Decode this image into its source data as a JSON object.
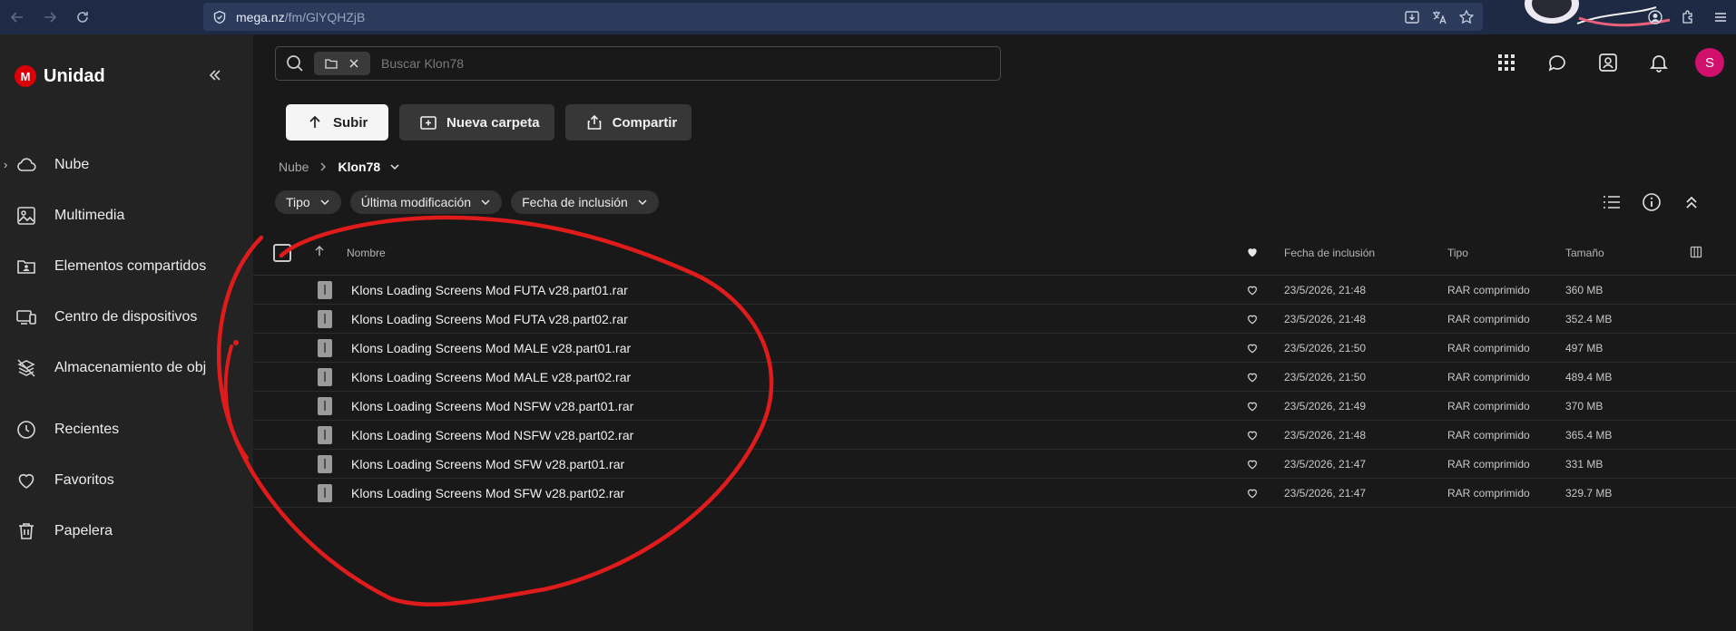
{
  "browser": {
    "url_host": "mega.nz",
    "url_path": "/fm/GlYQHZjB"
  },
  "sidebar": {
    "brand": "Unidad",
    "logo_letter": "M",
    "items": [
      {
        "label": "Nube",
        "icon": "cloud-icon"
      },
      {
        "label": "Multimedia",
        "icon": "image-icon"
      },
      {
        "label": "Elementos compartidos",
        "icon": "shared-folder-icon"
      },
      {
        "label": "Centro de dispositivos",
        "icon": "devices-icon"
      },
      {
        "label": "Almacenamiento de obj",
        "icon": "object-storage-icon"
      },
      {
        "label": "Recientes",
        "icon": "clock-icon"
      },
      {
        "label": "Favoritos",
        "icon": "heart-icon"
      },
      {
        "label": "Papelera",
        "icon": "trash-icon"
      }
    ]
  },
  "search": {
    "placeholder": "Buscar Klon78"
  },
  "header": {
    "avatar_letter": "S"
  },
  "actions": {
    "upload": "Subir",
    "new_folder": "Nueva carpeta",
    "share": "Compartir"
  },
  "breadcrumb": {
    "root": "Nube",
    "current": "Klon78"
  },
  "filters": {
    "type": "Tipo",
    "last_modified": "Última modificación",
    "date_added": "Fecha de inclusión"
  },
  "table": {
    "headers": {
      "name": "Nombre",
      "date": "Fecha de inclusión",
      "type": "Tipo",
      "size": "Tamaño"
    },
    "rows": [
      {
        "name": "Klons Loading Screens Mod FUTA v28.part01.rar",
        "date": "23/5/2026, 21:48",
        "type": "RAR comprimido",
        "size": "360 MB"
      },
      {
        "name": "Klons Loading Screens Mod FUTA v28.part02.rar",
        "date": "23/5/2026, 21:48",
        "type": "RAR comprimido",
        "size": "352.4 MB"
      },
      {
        "name": "Klons Loading Screens Mod MALE v28.part01.rar",
        "date": "23/5/2026, 21:50",
        "type": "RAR comprimido",
        "size": "497 MB"
      },
      {
        "name": "Klons Loading Screens Mod MALE v28.part02.rar",
        "date": "23/5/2026, 21:50",
        "type": "RAR comprimido",
        "size": "489.4 MB"
      },
      {
        "name": "Klons Loading Screens Mod NSFW v28.part01.rar",
        "date": "23/5/2026, 21:49",
        "type": "RAR comprimido",
        "size": "370 MB"
      },
      {
        "name": "Klons Loading Screens Mod NSFW v28.part02.rar",
        "date": "23/5/2026, 21:48",
        "type": "RAR comprimido",
        "size": "365.4 MB"
      },
      {
        "name": "Klons Loading Screens Mod SFW v28.part01.rar",
        "date": "23/5/2026, 21:47",
        "type": "RAR comprimido",
        "size": "331 MB"
      },
      {
        "name": "Klons Loading Screens Mod SFW v28.part02.rar",
        "date": "23/5/2026, 21:47",
        "type": "RAR comprimido",
        "size": "329.7 MB"
      }
    ]
  },
  "colors": {
    "accent_red": "#d90007",
    "avatar_pink": "#d0106c",
    "annotation_red": "#e01b1b"
  }
}
